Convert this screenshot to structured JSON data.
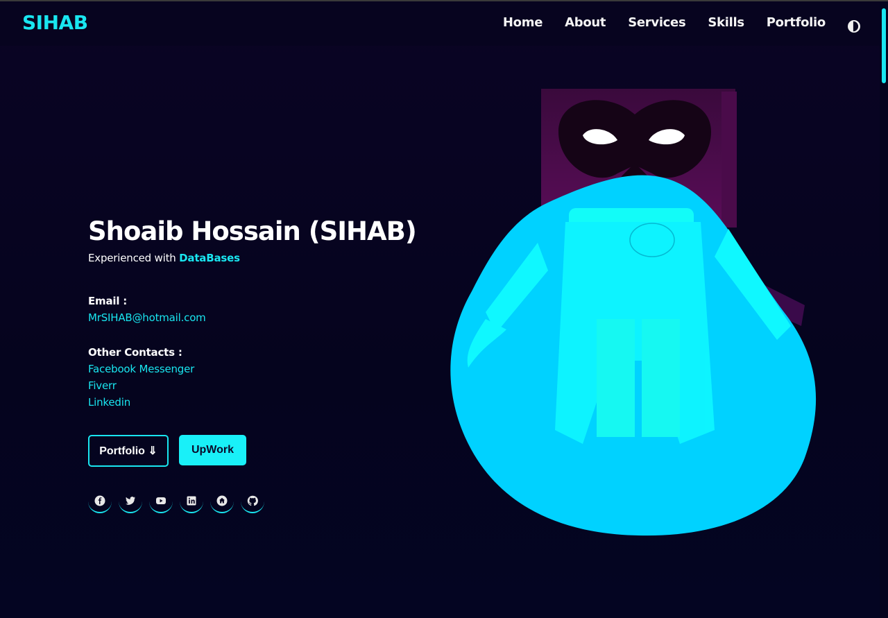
{
  "brand": {
    "logo": "SIHAB"
  },
  "nav": {
    "items": [
      "Home",
      "About",
      "Services",
      "Skills",
      "Portfolio"
    ],
    "theme_toggle_icon": "half-circle-icon"
  },
  "hero": {
    "name": "Shoaib Hossain (SIHAB)",
    "tagline_prefix": "Experienced with ",
    "tagline_highlight": "DataBases",
    "email_label": "Email :",
    "email": "MrSIHAB@hotmail.com",
    "contacts_label": "Other Contacts :",
    "contacts": [
      "Facebook Messenger",
      "Fiverr",
      "Linkedin"
    ],
    "buttons": {
      "portfolio": "Portfolio ⇓",
      "upwork": "UpWork"
    },
    "socials": [
      "facebook-icon",
      "twitter-icon",
      "youtube-icon",
      "linkedin-icon",
      "home-icon",
      "github-icon"
    ]
  },
  "colors": {
    "accent": "#19e6f0",
    "background": "#05041e",
    "blob": "#00d2ff"
  }
}
